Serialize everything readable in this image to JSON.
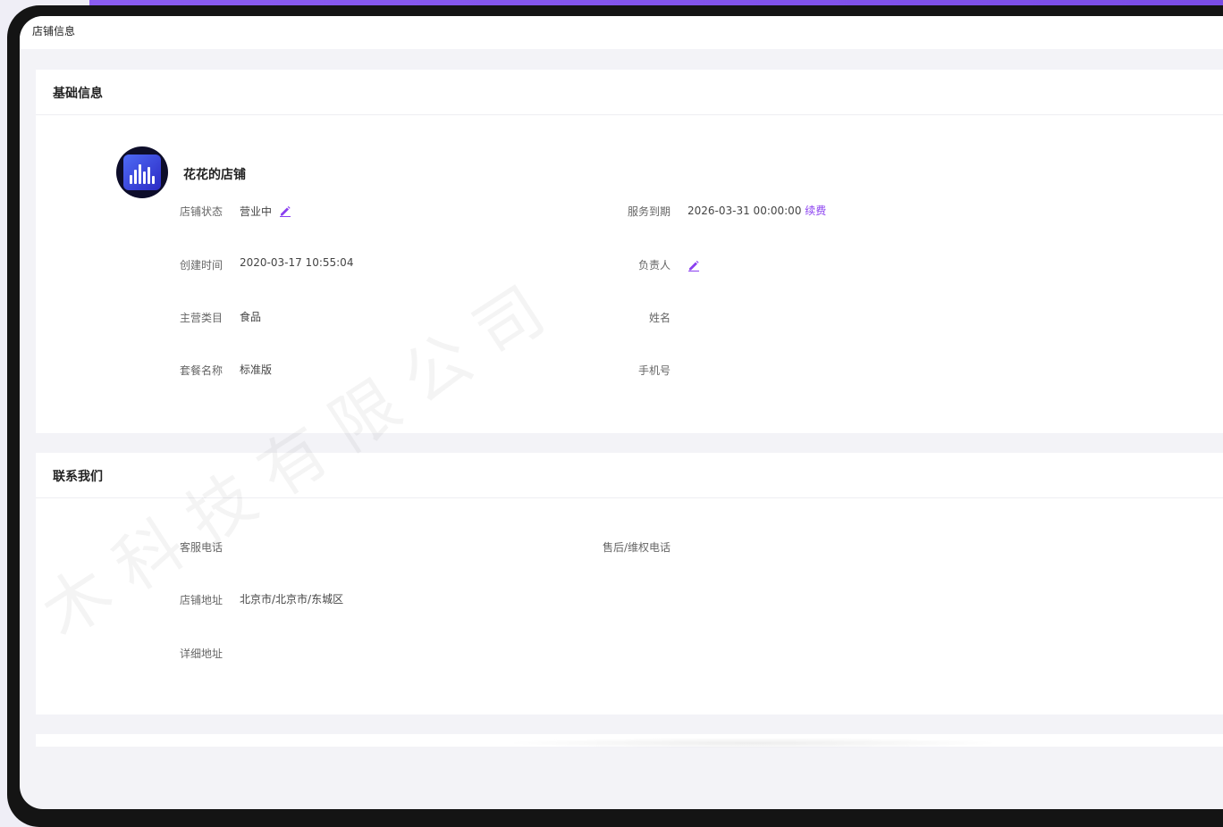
{
  "colors": {
    "accent": "#8a3ff0",
    "bezel": "#141414",
    "wallpaper": "#8a5cf0"
  },
  "topbar": {
    "title": "店铺信息"
  },
  "basic": {
    "title": "基础信息",
    "shop_name": "花花的店铺",
    "status_label": "店铺状态",
    "status_value": "营业中",
    "created_label": "创建时间",
    "created_value": "2020-03-17 10:55:04",
    "category_label": "主营类目",
    "category_value": "食品",
    "plan_label": "套餐名称",
    "plan_value": "标准版",
    "expiry_label": "服务到期",
    "expiry_value": "2026-03-31 00:00:00",
    "renew_label": "续费",
    "owner_label": "负责人",
    "name_label": "姓名",
    "phone_label": "手机号"
  },
  "contact": {
    "title": "联系我们",
    "service_phone_label": "客服电话",
    "aftersale_phone_label": "售后/维权电话",
    "address_label": "店铺地址",
    "address_value": "北京市/北京市/东城区",
    "detail_address_label": "详细地址"
  },
  "watermark": {
    "text": "木科技有限公司"
  }
}
